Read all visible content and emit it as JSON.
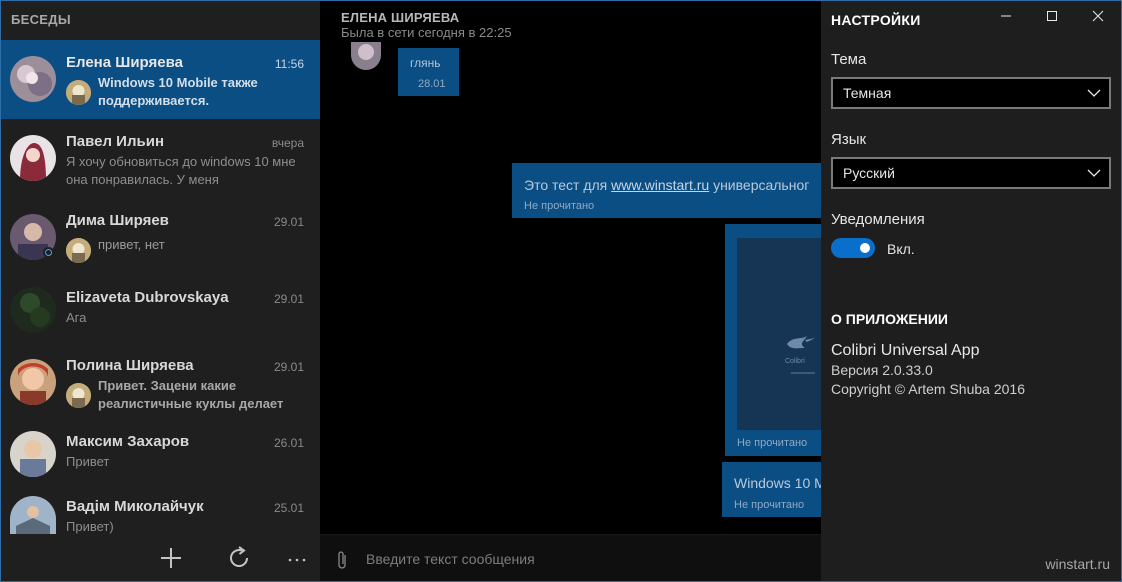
{
  "sidebar": {
    "title": "БЕСЕДЫ",
    "conversations": [
      {
        "name": "Елена Ширяева",
        "time": "11:56",
        "preview": "Windows 10 Mobile также поддерживается."
      },
      {
        "name": "Павел Ильин",
        "time": "вчера",
        "preview": "Я хочу обновиться до windows 10 мне она понравилась. У меня"
      },
      {
        "name": "Дима Ширяев",
        "time": "29.01",
        "preview": "привет, нет"
      },
      {
        "name": "Elizaveta Dubrovskaya",
        "time": "29.01",
        "preview": "Ага"
      },
      {
        "name": "Полина Ширяева",
        "time": "29.01",
        "preview": "Привет. Зацени какие реалистичные куклы делает"
      },
      {
        "name": "Максим Захаров",
        "time": "26.01",
        "preview": "Привет"
      },
      {
        "name": "Вадім Миколайчук",
        "time": "25.01",
        "preview": "Привет)"
      }
    ],
    "bottom": {
      "add_icon": "plus-icon",
      "refresh_icon": "refresh-icon",
      "more_icon": "more-icon"
    }
  },
  "chat": {
    "contact_name": "ЕЛЕНА ШИРЯЕВА",
    "status": "Была в сети сегодня в 22:25",
    "messages": [
      {
        "text": "глянь",
        "meta": "28.01"
      },
      {
        "text": "Это тест для www.winstart.ru универсальног",
        "link": "www.winstart.ru",
        "prefix": "Это тест для ",
        "suffix": " универсальног",
        "meta": "Не прочитано"
      },
      {
        "text": "",
        "meta": "Не прочитано",
        "image_caption": "Colibri"
      },
      {
        "text": "Windows 10 M",
        "meta": "Не прочитано"
      }
    ],
    "input_placeholder": "Введите текст сообщения"
  },
  "settings": {
    "title": "НАСТРОЙКИ",
    "theme_label": "Тема",
    "theme_value": "Темная",
    "language_label": "Язык",
    "language_value": "Русский",
    "notifications_label": "Уведомления",
    "notifications_state": "Вкл.",
    "about_title": "О ПРИЛОЖЕНИИ",
    "app_name": "Colibri Universal App",
    "version": "Версия 2.0.33.0",
    "copyright": "Copyright © Artem Shuba 2016"
  },
  "watermark": "winstart.ru",
  "colors": {
    "accent": "#0b4e83",
    "toggle_on": "#0a6ecb",
    "sidebar_bg": "#1f1f1f",
    "settings_bg": "#1e1e1e"
  }
}
